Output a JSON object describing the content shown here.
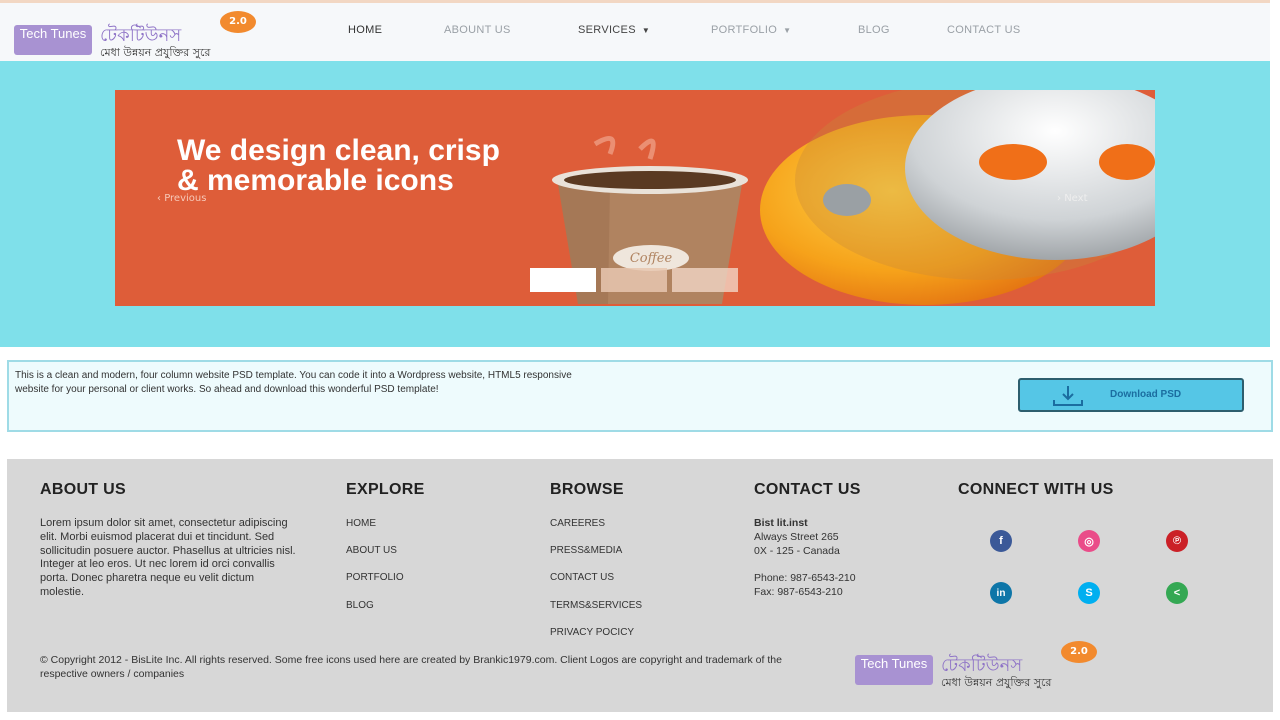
{
  "header": {
    "logo": {
      "box_text": "Tech Tunes",
      "main": "টেকটিউনস",
      "badge": "2.0",
      "tagline": "মেধা উন্নয়ন প্রযুক্তির সুরে"
    },
    "nav": [
      {
        "label": "HOME"
      },
      {
        "label": "ABOUNT US"
      },
      {
        "label": "SERVICES",
        "caret": "▼"
      },
      {
        "label": "PORTFOLIO",
        "caret": "▼"
      },
      {
        "label": "BLOG"
      },
      {
        "label": "CONTACT US"
      }
    ]
  },
  "hero": {
    "headline": "We design clean, crisp & memorable icons",
    "prev": "Previous",
    "next": "Next",
    "cup_label": "Coffee",
    "colors": {
      "background": "#7fe0ea",
      "slide": "#de5d39"
    }
  },
  "promo": {
    "text": "This is a clean and modern, four column website PSD template. You can code it into a Wordpress website, HTML5 responsive website for your personal or client works. So ahead and download this wonderful PSD template!",
    "button": "Download PSD"
  },
  "footer": {
    "about": {
      "heading": "ABOUT US",
      "text": "Lorem ipsum dolor sit amet, consectetur adipiscing elit. Morbi euismod placerat dui et tincidunt. Sed sollicitudin posuere auctor. Phasellus at ultricies nisl. Integer at leo eros. Ut nec lorem id orci convallis porta. Donec pharetra neque eu velit dictum molestie."
    },
    "explore": {
      "heading": "EXPLORE",
      "links": [
        "HOME",
        "ABOUT US",
        "PORTFOLIO",
        "BLOG"
      ]
    },
    "browse": {
      "heading": "BROWSE",
      "links": [
        "CAREERES",
        "PRESS&MEDIA",
        "CONTACT US",
        "TERMS&SERVICES",
        "PRIVACY POCICY"
      ]
    },
    "contact": {
      "heading": "CONTACT US",
      "name": "Bist lit.inst",
      "street": "Always Street 265",
      "city": "0X - 125 - Canada",
      "phone": "Phone: 987-6543-210",
      "fax": "Fax: 987-6543-210"
    },
    "connect": {
      "heading": "CONNECT WITH US",
      "icons": [
        {
          "name": "facebook-icon",
          "glyph": "f",
          "color": "#3b5998"
        },
        {
          "name": "dribbble-icon",
          "glyph": "◎",
          "color": "#ea4c89"
        },
        {
          "name": "pinterest-icon",
          "glyph": "℗",
          "color": "#cb2027"
        },
        {
          "name": "linkedin-icon",
          "glyph": "in",
          "color": "#0e76a8"
        },
        {
          "name": "skype-icon",
          "glyph": "S",
          "color": "#00aff0"
        },
        {
          "name": "share-icon",
          "glyph": "<",
          "color": "#34a853"
        }
      ]
    },
    "copyright": "© Copyright 2012 - BisLite Inc. All rights reserved. Some free icons used here are created by Brankic1979.com. Client Logos are copyright and trademark of the respective owners / companies"
  }
}
